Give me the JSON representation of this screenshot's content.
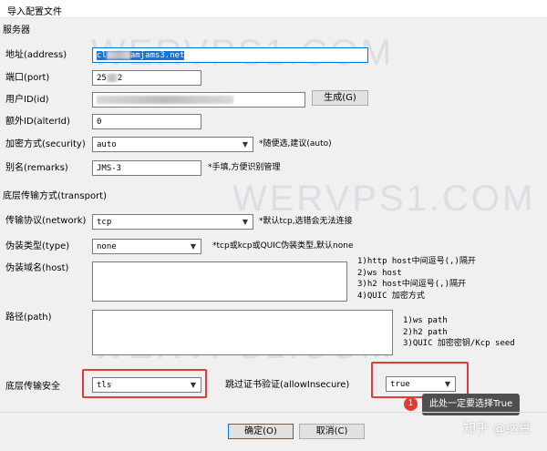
{
  "window": {
    "title": "导入配置文件"
  },
  "server": {
    "section_label": "服务器",
    "address": {
      "label": "地址(address)",
      "value_prefix": "cl",
      "value_selected": "amjams3.net"
    },
    "port": {
      "label": "端口(port)",
      "value_prefix": "25",
      "value_suffix": "2"
    },
    "user_id": {
      "label": "用户ID(id)",
      "generate_label": "生成(G)"
    },
    "alter_id": {
      "label": "额外ID(alterId)",
      "value": "0"
    },
    "security": {
      "label": "加密方式(security)",
      "value": "auto",
      "hint": "*随便选,建议(auto)"
    },
    "remarks": {
      "label": "别名(remarks)",
      "value": "JMS-3",
      "hint": "*手填,方便识别管理"
    }
  },
  "transport": {
    "section_label": "底层传输方式(transport)",
    "network": {
      "label": "传输协议(network)",
      "value": "tcp",
      "hint": "*默认tcp,选错会无法连接"
    },
    "type": {
      "label": "伪装类型(type)",
      "value": "none",
      "hint": "*tcp或kcp或QUIC伪装类型,默认none"
    },
    "host": {
      "label": "伪装域名(host)",
      "hints": [
        "1)http host中间逗号(,)隔开",
        "2)ws host",
        "3)h2 host中间逗号(,)隔开",
        "4)QUIC 加密方式"
      ]
    },
    "path": {
      "label": "路径(path)",
      "hints": [
        "1)ws path",
        "2)h2 path",
        "3)QUIC 加密密钥/Kcp seed"
      ]
    },
    "tls": {
      "label": "底层传输安全",
      "value": "tls"
    },
    "allow_insecure": {
      "label": "跳过证书验证(allowInsecure)",
      "value": "true"
    }
  },
  "annotation": {
    "badge": "1",
    "text": "此处一定要选择True"
  },
  "buttons": {
    "ok": "确定(O)",
    "cancel": "取消(C)"
  },
  "watermark": "WERVPS1.COM",
  "credit": "知乎 @纳豆",
  "colors": {
    "accent": "#0078d7",
    "selection": "#1a74d6",
    "annotation_red": "#e23b3b"
  }
}
